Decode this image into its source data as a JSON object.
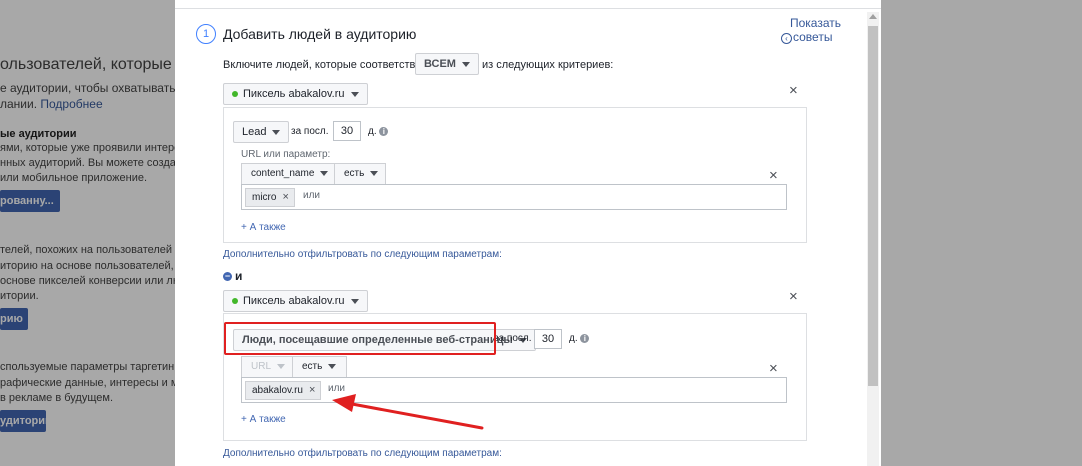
{
  "background": {
    "title": "ользователей, которые вам",
    "lines": [
      "е аудитории, чтобы охватывать поль",
      "лании.",
      "ые аудитории",
      "ями, которые уже проявили интерес к ваш",
      "нных аудиторий. Вы можете создать ауди",
      "или мобильное приложение.",
      "телей, похожих на пользователей аудитор",
      "иторию на основе пользователей, которые",
      "основе пикселей конверсии или любой су",
      "итории.",
      "спользуемые параметры таргетинга для и",
      "рафические данные, интересы и модели",
      "в рекламе в будущем."
    ],
    "more_link": "Подробнее",
    "buttons": [
      "рованну...",
      "рию",
      "удиторию"
    ]
  },
  "dialog": {
    "step_number": "1",
    "step_title": "Добавить людей в аудиторию",
    "tips_link": {
      "line1": "Показать",
      "line2": "советы",
      "icon": "chevron-left-circle-icon"
    },
    "criteria": {
      "prefix": "Включите людей, которые соответствуют",
      "selector": "ВСЕМ",
      "suffix": "из следующих критериев:"
    },
    "rules": [
      {
        "source": "Пиксель abakalov.ru",
        "event": "Lead",
        "in_last_label": "за посл.",
        "days_value": "30",
        "days_unit": "д.",
        "param_label": "URL или параметр:",
        "param_name": "content_name",
        "operator": "есть",
        "tokens": [
          "micro"
        ],
        "or_placeholder": "или",
        "add_also": "+ А также",
        "filter_link": "Дополнительно отфильтровать по следующим параметрам:"
      },
      {
        "source": "Пиксель abakalov.ru",
        "event": "Люди, посещавшие определенные веб-страницы",
        "in_last_label": "за посл.",
        "days_value": "30",
        "days_unit": "д.",
        "param_name": "URL",
        "operator": "есть",
        "tokens": [
          "abakalov.ru"
        ],
        "or_placeholder": "или",
        "add_also": "+ А также",
        "filter_link": "Дополнительно отфильтровать по следующим параметрам:"
      }
    ],
    "and_label": "и",
    "info_glyph": "i",
    "close_glyph": "×"
  },
  "annotation": {
    "color": "#e02020"
  }
}
